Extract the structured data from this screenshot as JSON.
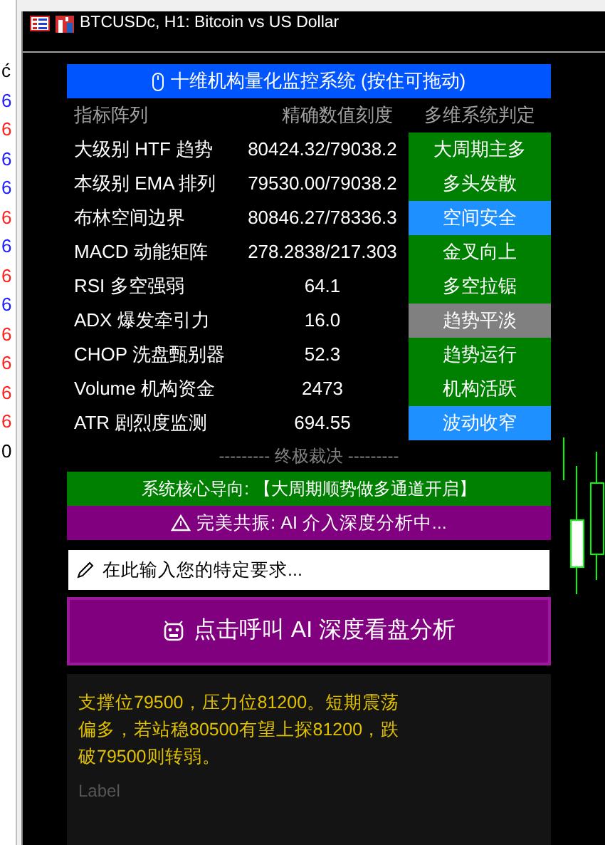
{
  "side_strip": [
    {
      "text": "ć",
      "color": "#000000"
    },
    {
      "text": "6",
      "color": "#2020ff"
    },
    {
      "text": "6",
      "color": "#ff2020"
    },
    {
      "text": "6",
      "color": "#2020ff"
    },
    {
      "text": "6",
      "color": "#2020ff"
    },
    {
      "text": "6",
      "color": "#ff2020"
    },
    {
      "text": "6",
      "color": "#2020ff"
    },
    {
      "text": "6",
      "color": "#ff2020"
    },
    {
      "text": "6",
      "color": "#2020ff"
    },
    {
      "text": "6",
      "color": "#ff2020"
    },
    {
      "text": "6",
      "color": "#ff2020"
    },
    {
      "text": "6",
      "color": "#ff2020"
    },
    {
      "text": "6",
      "color": "#ff2020"
    },
    {
      "text": "0",
      "color": "#000000"
    }
  ],
  "window": {
    "title": "BTCUSDc, H1:  Bitcoin vs US Dollar"
  },
  "panel": {
    "title": "十维机构量化监控系统 (按住可拖动)",
    "columns": [
      "指标阵列",
      "精确数值刻度",
      "多维系统判定"
    ],
    "rows": [
      {
        "name": "大级别 HTF 趋势",
        "value": "80424.32/79038.2",
        "verdict": "大周期主多",
        "color": "#008000"
      },
      {
        "name": "本级别 EMA 排列",
        "value": "79530.00/79038.2",
        "verdict": "多头发散",
        "color": "#008000"
      },
      {
        "name": "布林空间边界",
        "value": "80846.27/78336.3",
        "verdict": "空间安全",
        "color": "#1e90ff"
      },
      {
        "name": "MACD 动能矩阵",
        "value": "278.2838/217.303",
        "verdict": "金叉向上",
        "color": "#008000"
      },
      {
        "name": "RSI 多空强弱",
        "value": "64.1",
        "verdict": "多空拉锯",
        "color": "#008000"
      },
      {
        "name": "ADX 爆发牵引力",
        "value": "16.0",
        "verdict": "趋势平淡",
        "color": "#808080"
      },
      {
        "name": "CHOP 洗盘甄别器",
        "value": "52.3",
        "verdict": "趋势运行",
        "color": "#008000"
      },
      {
        "name": "Volume 机构资金",
        "value": "2473",
        "verdict": "机构活跃",
        "color": "#008000"
      },
      {
        "name": "ATR 剧烈度监测",
        "value": "694.55",
        "verdict": "波动收窄",
        "color": "#1e90ff"
      }
    ],
    "divider": "--------- 终极裁决 ---------",
    "core": "系统核心导向: 【大周期顺势做多通道开启】",
    "resonance": "完美共振: AI 介入深度分析中...",
    "input": {
      "placeholder": "在此输入您的特定要求..."
    },
    "ai_button": "点击呼叫 AI 深度看盘分析",
    "analysis": "支撑位79500，压力位81200。短期震荡偏多，若站稳80500有望上探81200，跌破79500则转弱。",
    "label": "Label"
  }
}
